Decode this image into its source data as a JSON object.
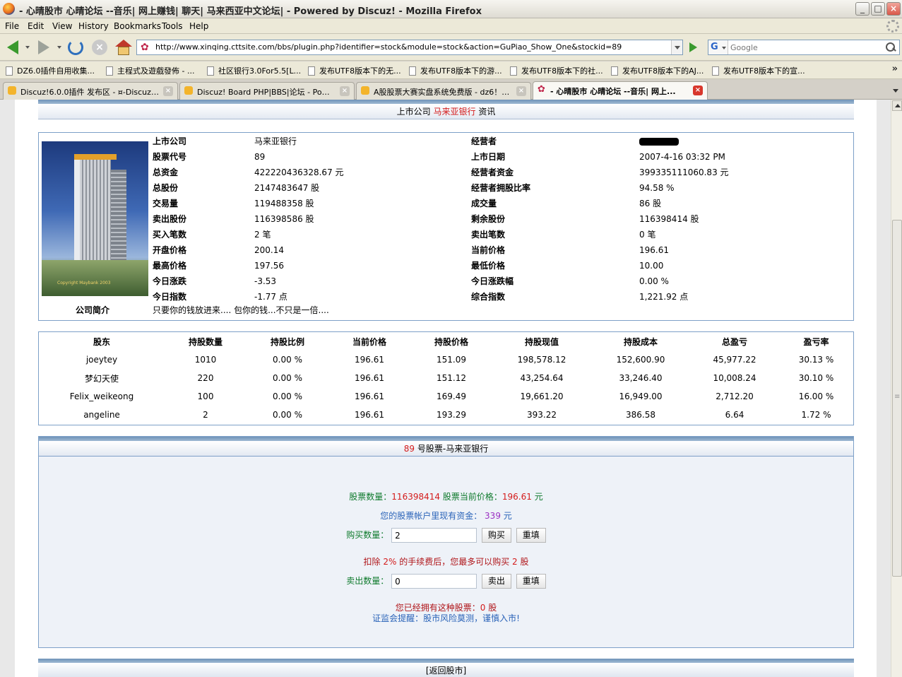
{
  "window": {
    "title": "- 心晴股市 心晴论坛 --音乐| 网上赚钱| 聊天| 马来西亚中文论坛| - Powered by Discuz! - Mozilla Firefox",
    "minimize": "_",
    "maximize": "□",
    "close": "×"
  },
  "menu": [
    "File",
    "Edit",
    "View",
    "History",
    "Bookmarks",
    "Tools",
    "Help"
  ],
  "nav": {
    "url": "http://www.xinqing.cttsite.com/bbs/plugin.php?identifier=stock&module=stock&action=GuPiao_Show_One&stockid=89",
    "search_engine": "G",
    "search_placeholder": "Google"
  },
  "bookmarks": [
    "DZ6.0插件自用收集...",
    "主程式及遊戲發佈 - ...",
    "社区银行3.0For5.5[L...",
    "发布UTF8版本下的无...",
    "发布UTF8版本下的游...",
    "发布UTF8版本下的社...",
    "发布UTF8版本下的AJ...",
    "发布UTF8版本下的宣..."
  ],
  "bookmarks_more": "»",
  "tabs": [
    {
      "label": "Discuz!6.0.0插件 发布区 - ¤-Discuz!插...",
      "close": "×"
    },
    {
      "label": "Discuz! Board PHP|BBS|论坛 - Powere...",
      "close": "×"
    },
    {
      "label": "A股股票大赛实盘系统免费版 - dz6！5...",
      "close": "×"
    },
    {
      "label": "- 心晴股市 心晴论坛 --音乐| 网上...",
      "close": "×"
    }
  ],
  "header": {
    "prefix": "上市公司",
    "company": "马来亚银行",
    "suffix": "资讯"
  },
  "info": {
    "left": [
      {
        "label": "上市公司",
        "value": "马来亚银行"
      },
      {
        "label": "股票代号",
        "value": "89"
      },
      {
        "label": "总资金",
        "value": "422220436328.67 元"
      },
      {
        "label": "总股份",
        "value": "2147483647 股"
      },
      {
        "label": "交易量",
        "value": "119488358 股"
      },
      {
        "label": "卖出股份",
        "value": "116398586 股"
      },
      {
        "label": "买入笔数",
        "value": "2 笔"
      },
      {
        "label": "开盘价格",
        "value": "200.14"
      },
      {
        "label": "最高价格",
        "value": "197.56"
      },
      {
        "label": "今日涨跌",
        "value": "-3.53"
      },
      {
        "label": "今日指数",
        "value": "-1.77 点"
      }
    ],
    "right": [
      {
        "label": "经营者",
        "value": ""
      },
      {
        "label": "上市日期",
        "value": "2007-4-16 03:32 PM"
      },
      {
        "label": "经营者资金",
        "value": "399335111060.83 元"
      },
      {
        "label": "经营者拥股比率",
        "value": "94.58 %"
      },
      {
        "label": "成交量",
        "value": "86 股"
      },
      {
        "label": "剩余股份",
        "value": "116398414 股"
      },
      {
        "label": "卖出笔数",
        "value": "0 笔"
      },
      {
        "label": "当前价格",
        "value": "196.61"
      },
      {
        "label": "最低价格",
        "value": "10.00"
      },
      {
        "label": "今日涨跌幅",
        "value": "0.00 %"
      },
      {
        "label": "综合指数",
        "value": "1,221.92 点"
      }
    ],
    "intro_label": "公司简介",
    "intro_text": "只要你的钱放进来.... 包你的钱...不只是一倍....",
    "photo_caption": "Copyright Maybank 2003"
  },
  "holders": {
    "columns": [
      "股东",
      "持股数量",
      "持股比例",
      "当前价格",
      "持股价格",
      "持股现值",
      "持股成本",
      "总盈亏",
      "盈亏率"
    ],
    "rows": [
      [
        "joeytey",
        "1010",
        "0.00 %",
        "196.61",
        "151.09",
        "198,578.12",
        "152,600.90",
        "45,977.22",
        "30.13 %"
      ],
      [
        "梦幻天使",
        "220",
        "0.00 %",
        "196.61",
        "151.12",
        "43,254.64",
        "33,246.40",
        "10,008.24",
        "30.10 %"
      ],
      [
        "Felix_weikeong",
        "100",
        "0.00 %",
        "196.61",
        "169.49",
        "19,661.20",
        "16,949.00",
        "2,712.20",
        "16.00 %"
      ],
      [
        "angeline",
        "2",
        "0.00 %",
        "196.61",
        "193.29",
        "393.22",
        "386.58",
        "6.64",
        "1.72 %"
      ]
    ]
  },
  "trade": {
    "title_num": "89",
    "title_text": "号股票-马来亚银行",
    "qty_label": "股票数量：",
    "qty_value": "116398414",
    "price_label": "股票当前价格：",
    "price_value": "196.61",
    "price_unit": "元",
    "funds_label": "您的股票帐户里现有资金：",
    "funds_value": "339",
    "funds_unit": "元",
    "buy_label": "购买数量：",
    "buy_value": "2",
    "buy_button": "购买",
    "reset_button": "重填",
    "fee_note_1": "扣除",
    "fee_pct": "2%",
    "fee_note_2": "的手续费后，您最多可以购买",
    "fee_max": "2",
    "fee_unit": "股",
    "sell_label": "卖出数量：",
    "sell_value": "0",
    "sell_button": "卖出",
    "owned_label": "您已经拥有这种股票：",
    "owned_value": "0",
    "owned_unit": "股",
    "warning_prefix": "证监会提醒：",
    "warning_text": "股市风险莫测，谨慎入市!"
  },
  "back_link": "[返回股市]"
}
